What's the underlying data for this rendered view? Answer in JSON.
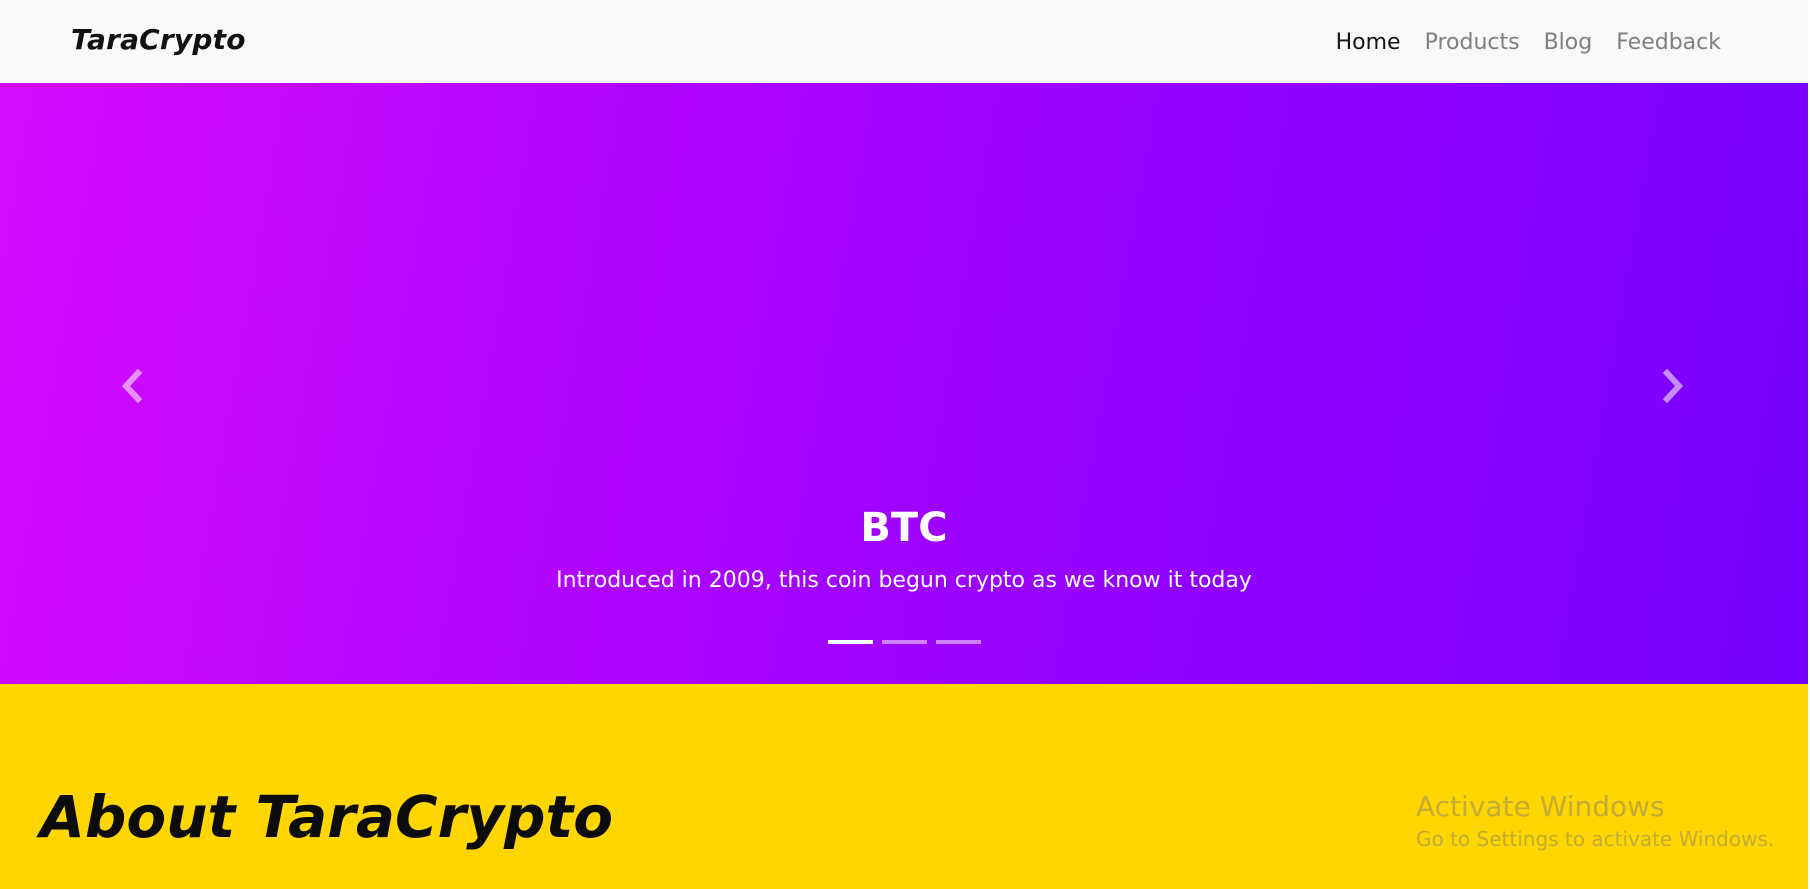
{
  "navbar": {
    "brand": "TaraCrypto",
    "links": [
      {
        "label": "Home",
        "active": true
      },
      {
        "label": "Products",
        "active": false
      },
      {
        "label": "Blog",
        "active": false
      },
      {
        "label": "Feedback",
        "active": false
      }
    ]
  },
  "carousel": {
    "gradient_colors": [
      "#d50cff",
      "#a202ff",
      "#7500ff"
    ],
    "prev_icon": "chevron-left-icon",
    "next_icon": "chevron-right-icon",
    "caption": {
      "title": "BTC",
      "text": "Introduced in 2009, this coin begun crypto as we know it today"
    },
    "slide_count": 3,
    "active_slide": 1
  },
  "about": {
    "title": "About TaraCrypto",
    "background": "#ffd600"
  },
  "watermark": {
    "title": "Activate Windows",
    "subtitle": "Go to Settings to activate Windows."
  }
}
